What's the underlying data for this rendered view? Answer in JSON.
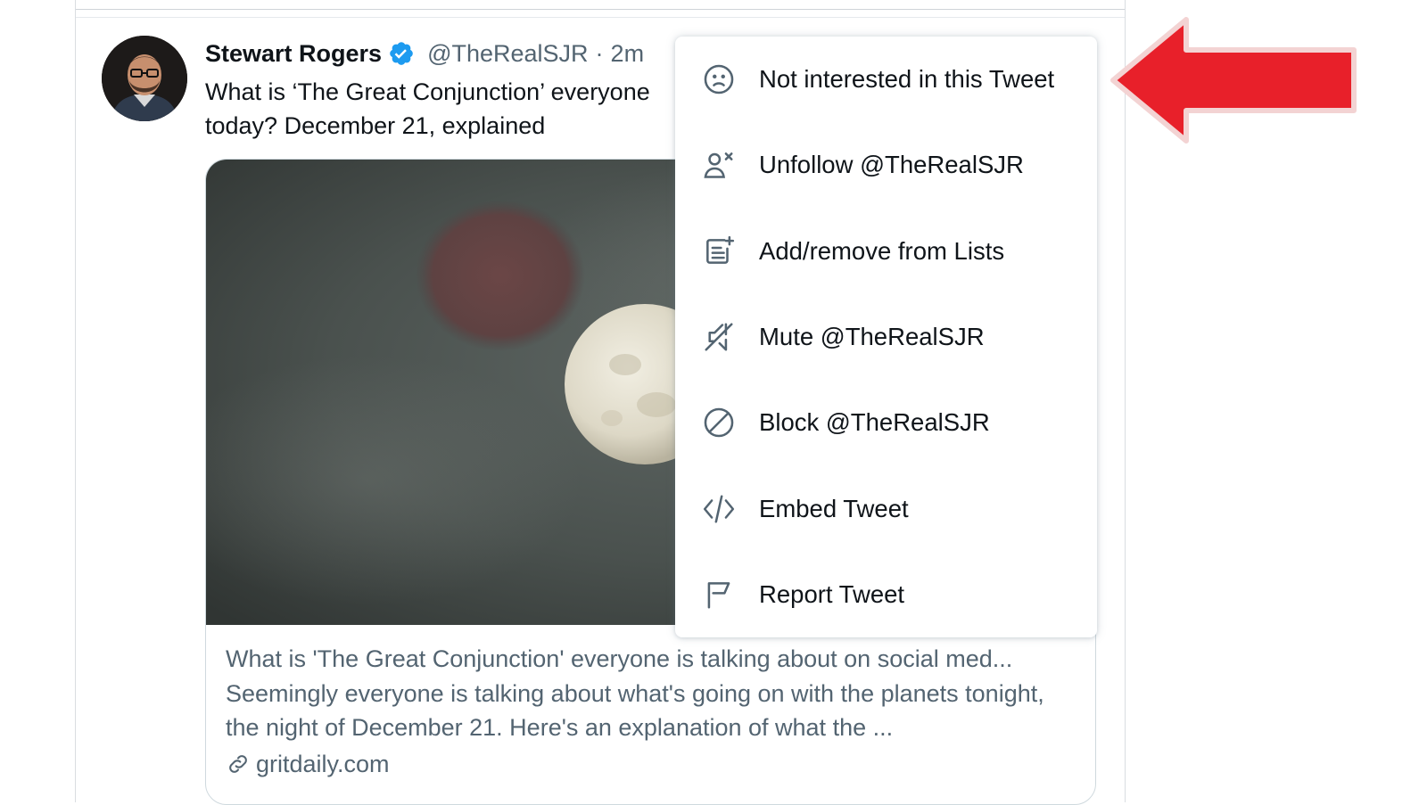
{
  "tweet": {
    "author_name": "Stewart Rogers",
    "handle": "@TheRealSJR",
    "separator": "·",
    "time": "2m",
    "text_line1": "What is ‘The Great Conjunction’ everyone",
    "text_line2": "today? December 21, explained"
  },
  "card": {
    "title": "What is 'The Great Conjunction' everyone is talking about on social med...",
    "description": "Seemingly everyone is talking about what's going on with the planets tonight, the night of December 21. Here's an explanation of what the ...",
    "domain": "gritdaily.com"
  },
  "menu": {
    "items": [
      {
        "label": "Not interested in this Tweet",
        "icon": "frown-face-icon"
      },
      {
        "label": "Unfollow @TheRealSJR",
        "icon": "unfollow-user-icon"
      },
      {
        "label": "Add/remove from Lists",
        "icon": "list-add-icon"
      },
      {
        "label": "Mute @TheRealSJR",
        "icon": "mute-speaker-icon"
      },
      {
        "label": "Block @TheRealSJR",
        "icon": "block-icon"
      },
      {
        "label": "Embed Tweet",
        "icon": "code-icon"
      },
      {
        "label": "Report Tweet",
        "icon": "flag-icon"
      }
    ]
  },
  "colors": {
    "text": "#0f1419",
    "secondary_text": "#536471",
    "verified": "#1d9bf0",
    "annotation_arrow": "#e8202a"
  }
}
